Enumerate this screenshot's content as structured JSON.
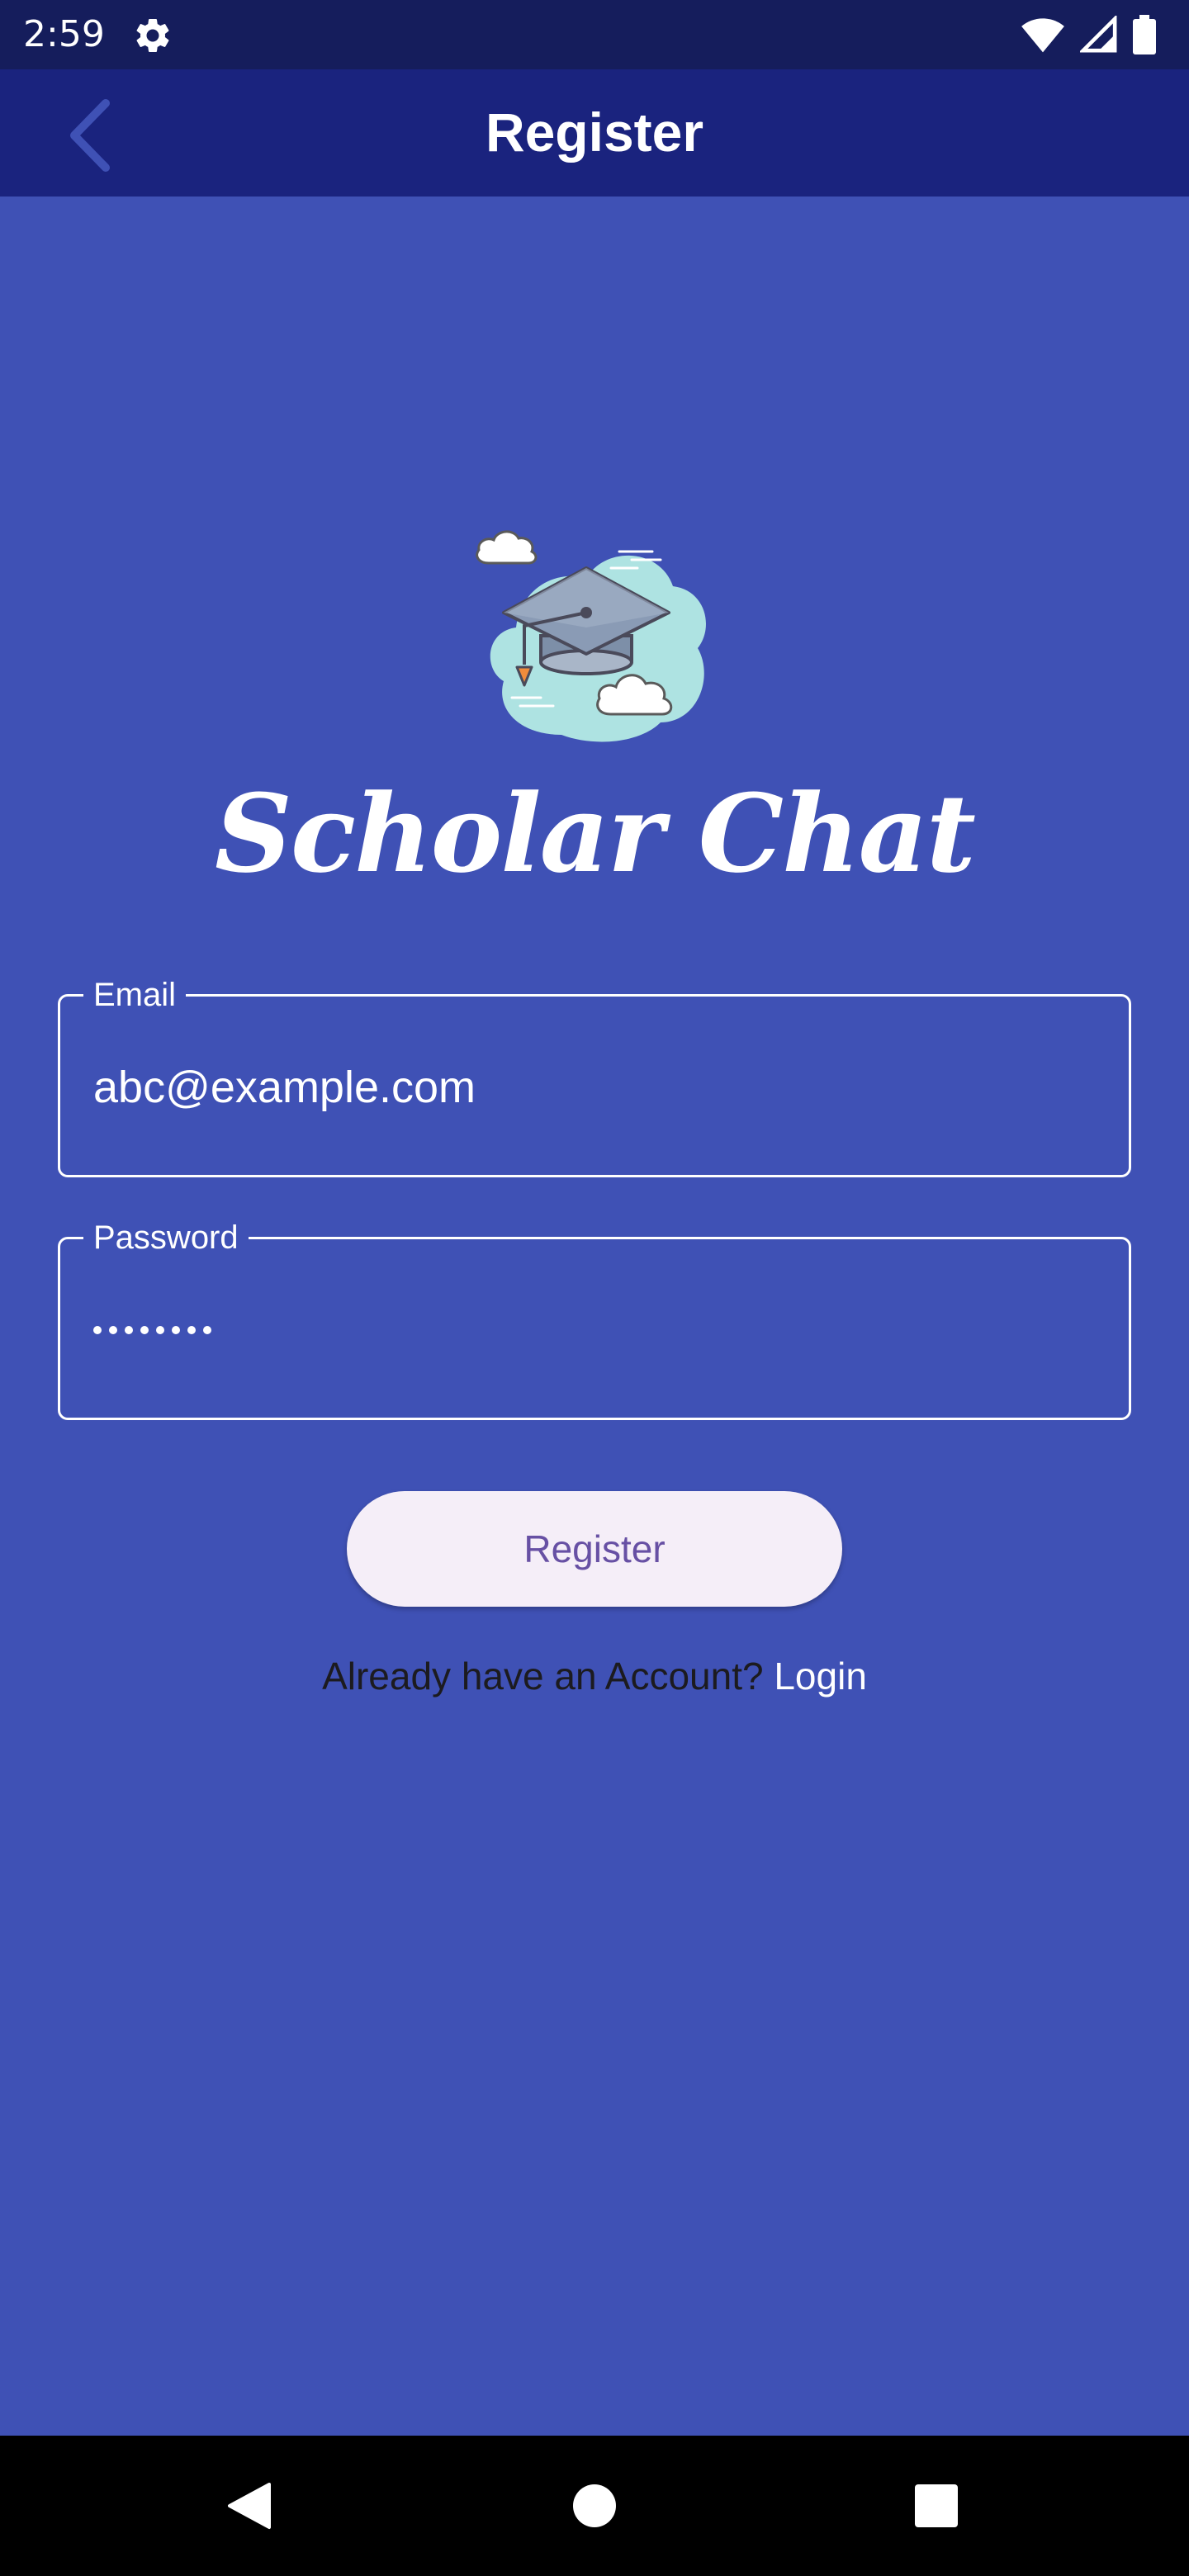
{
  "status_bar": {
    "time": "2:59",
    "icons": [
      "gear-icon",
      "wifi-icon",
      "signal-icon",
      "battery-icon"
    ]
  },
  "app_bar": {
    "title": "Register",
    "back_icon": "chevron-left-icon"
  },
  "brand": {
    "logo_icon": "graduation-cap-cloud-logo",
    "title": "Scholar Chat"
  },
  "form": {
    "email": {
      "label": "Email",
      "value": "abc@example.com"
    },
    "password": {
      "label": "Password",
      "masked_length": 8
    },
    "register_button": "Register",
    "login_prompt": "Already have an Account?",
    "login_link": "Login"
  },
  "colors": {
    "background": "#3f51b5",
    "app_bar": "#1a237e",
    "status_bar": "#151d5c",
    "button_bg": "#f5eef8",
    "button_text": "#6750a4"
  },
  "nav_bar": {
    "icons": [
      "back-triangle-icon",
      "home-circle-icon",
      "recents-square-icon"
    ]
  }
}
